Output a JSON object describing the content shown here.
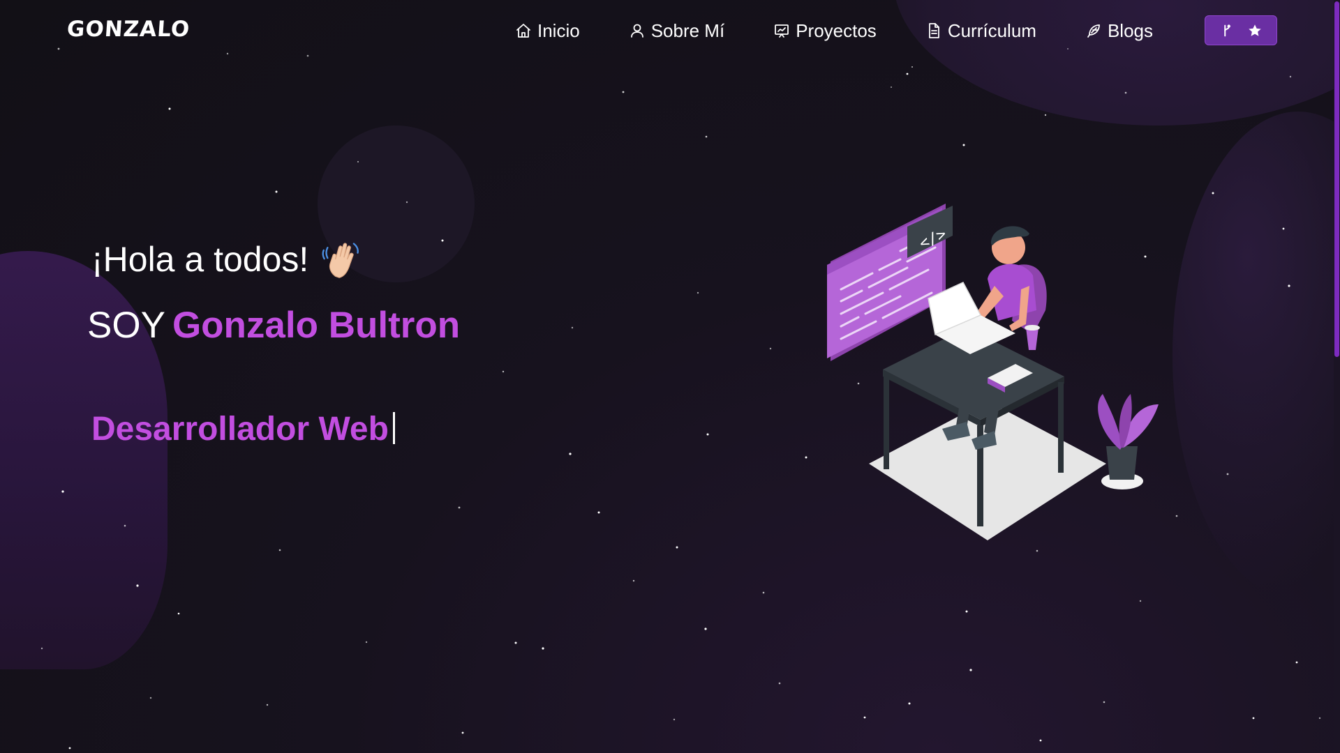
{
  "nav": {
    "logo": "GONZALO",
    "items": [
      {
        "label": "Inicio",
        "icon": "home-icon"
      },
      {
        "label": "Sobre Mí",
        "icon": "user-icon"
      },
      {
        "label": "Proyectos",
        "icon": "presentation-icon"
      },
      {
        "label": "Currículum",
        "icon": "document-icon"
      },
      {
        "label": "Blogs",
        "icon": "feather-icon"
      }
    ],
    "github_button": {
      "icons": [
        "git-fork-icon",
        "star-icon"
      ]
    }
  },
  "hero": {
    "greeting": "¡Hola a todos!",
    "greeting_emoji": "waving-hand-icon",
    "soy": "SOY",
    "name": "Gonzalo Bultron",
    "role": "Desarrollador Web"
  },
  "colors": {
    "accent": "#c24ee0",
    "button_bg": "#6a2fa3",
    "background": "#15121b"
  }
}
